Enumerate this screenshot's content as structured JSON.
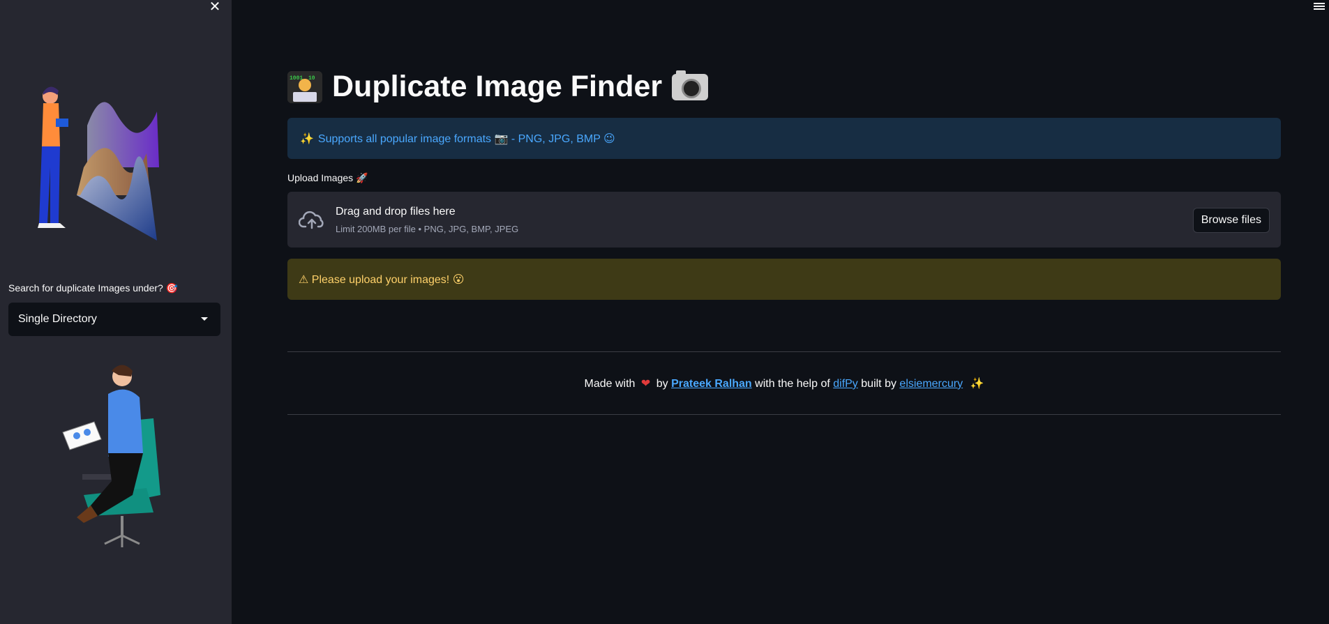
{
  "sidebar": {
    "close_glyph": "✕",
    "search_label": "Search for duplicate Images under? 🎯",
    "select_value": "Single Directory"
  },
  "main": {
    "title": "Duplicate Image Finder",
    "info_text": "Supports all popular image formats 📷 - PNG, JPG, BMP 😉",
    "info_spark": "✨",
    "upload_label": "Upload Images 🚀",
    "dropzone_title": "Drag and drop files here",
    "dropzone_sub": "Limit 200MB per file • PNG, JPG, BMP, JPEG",
    "browse_label": "Browse files",
    "warning_text": "⚠ Please upload your images! 😮"
  },
  "footer": {
    "made_with": "Made with",
    "heart": "❤",
    "by": "by",
    "author": "Prateek Ralhan",
    "help_text": "with the help of",
    "lib": "difPy",
    "built_by": "built by",
    "lib_author": "elsiemercury",
    "spark": "✨"
  },
  "colors": {
    "background": "#0e1117",
    "sidebar": "#262730",
    "info_bg": "#172d43",
    "info_text": "#4aa8ff",
    "warning_bg": "#3e3a16",
    "warning_text": "#ffd16a",
    "link": "#4aa8ff"
  },
  "icons": [
    "close-icon",
    "hamburger-menu-icon",
    "cloud-upload-icon",
    "chevron-down-icon",
    "coder-emoji-icon",
    "camera-icon"
  ]
}
